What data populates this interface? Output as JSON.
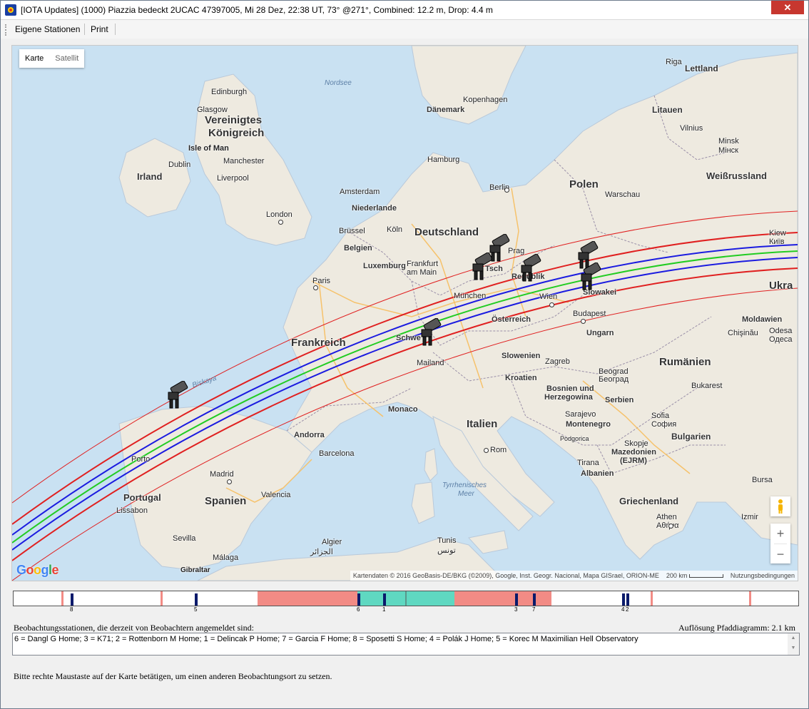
{
  "window": {
    "title": "[IOTA Updates] (1000) Piazzia bedeckt 2UCAC 47397005, Mi 28 Dez, 22:38 UT, 73° @271°, Combined: 12.2 m, Drop:  4.4 m",
    "close": "✕"
  },
  "menu": {
    "items": [
      "Eigene Stationen",
      "Print"
    ]
  },
  "map": {
    "type_toggle": [
      "Karte",
      "Satellit"
    ],
    "countries": [
      "Vereinigtes",
      "Königreich",
      "Irland",
      "Deutschland",
      "Polen",
      "Frankreich",
      "Litauen",
      "Lettland",
      "Weißrussland",
      "Ukra",
      "Italien",
      "Spanien",
      "Portugal",
      "Rumänien",
      "Griechenland",
      "Ungarn",
      "Österreich",
      "Serbien",
      "Bulgarien",
      "Albanien",
      "Kroatien",
      "Slowenien",
      "Moldawien",
      "Dänemark",
      "Niederlande",
      "Belgien",
      "Luxemburg",
      "Montenegro",
      "Bosnien und",
      "Herzegowina",
      "Mazedonien",
      "(EJRM)",
      "Andorra",
      "Monaco",
      "Schwe",
      "Slowakei",
      "Tsch",
      "Republik"
    ],
    "seas": [
      "Nordsee",
      "Tyrrhenisches",
      "Meer",
      "Biskaya"
    ],
    "cities": [
      "Riga",
      "Edinburgh",
      "Glasgow",
      "Kopenhagen",
      "Isle of Man",
      "Manchester",
      "Dublin",
      "Liverpool",
      "Hamburg",
      "Vilnius",
      "Minsk",
      "Мінск",
      "Berlin",
      "Warschau",
      "Amsterdam",
      "London",
      "Brüssel",
      "Köln",
      "Kiew",
      "Київ",
      "Frankfurt",
      "am Main",
      "Prag",
      "Paris",
      "München",
      "Wien",
      "Budapest",
      "Chişinău",
      "Odesa",
      "Одеса",
      "Zagreb",
      "Beograd",
      "Београд",
      "Mailand",
      "Sarajevo",
      "Bukarest",
      "Sofia",
      "София",
      "Podgorica",
      "Rom",
      "Porto",
      "Barcelona",
      "Madrid",
      "Valencia",
      "Tirana",
      "Lissabon",
      "Sevilla",
      "Málaga",
      "Gibraltar",
      "Algier",
      "الجزائر",
      "Tunis",
      "تونس",
      "Athen",
      "Αθήνα",
      "Bursa",
      "Izmir",
      "Skopje"
    ],
    "attribution": "Kartendaten © 2016 GeoBasis-DE/BKG (©2009), Google, Inst. Geogr. Nacional, Mapa GISrael, ORION-ME",
    "scale": "200 km",
    "terms": "Nutzungsbedingungen",
    "logo": "Google",
    "zoom_in": "+",
    "zoom_out": "−"
  },
  "path_diagram": {
    "ticks": [
      "8",
      "5",
      "6",
      "1",
      "3",
      "7",
      "4",
      "2"
    ]
  },
  "labels": {
    "stations_heading": "Beobachtungsstationen, die derzeit von Beobachtern angemeldet sind:",
    "resolution": "Auflösung Pfaddiagramm: 2.1 km",
    "stations": "6 = Dangl G Home; 3 = K71; 2 = Rottenborn M Home; 1 = Delincak P Home; 7 = Garcia F Home; 8 = Sposetti S Home; 4 = Polák J Home; 5 = Korec M Maximilian Hell Observatory",
    "hint": "Bitte rechte Maustaste auf der Karte betätigen, um einen anderen Beobachtungsort zu setzen."
  }
}
